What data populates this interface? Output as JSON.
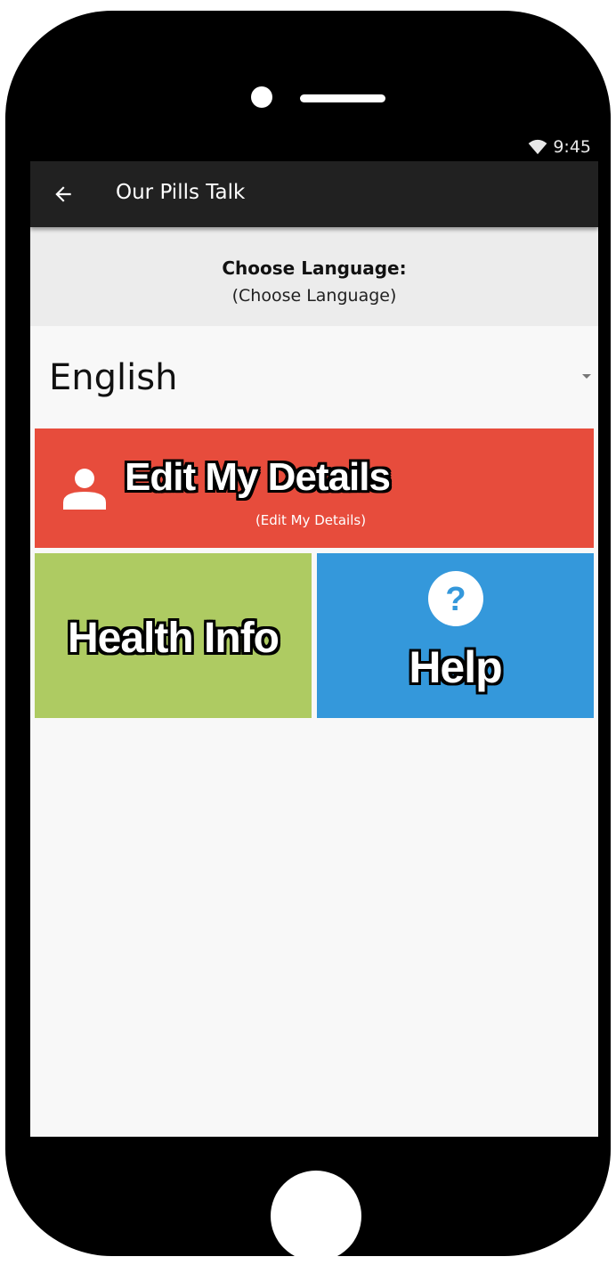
{
  "status_bar": {
    "time": "9:45",
    "wifi_icon": "wifi-icon"
  },
  "app_bar": {
    "back_icon": "arrow-left-icon",
    "title": "Our Pills Talk"
  },
  "language_header": {
    "title": "Choose Language:",
    "subtitle": "(Choose Language)"
  },
  "language_select": {
    "selected": "English"
  },
  "tiles": {
    "edit_details": {
      "icon": "person-icon",
      "label": "Edit My Details",
      "sublabel": "(Edit My Details)",
      "color": "#e74c3c"
    },
    "health_info": {
      "label": "Health Info",
      "color": "#aecb62"
    },
    "help": {
      "icon": "question-circle-icon",
      "label": "Help",
      "color": "#3498db"
    }
  }
}
